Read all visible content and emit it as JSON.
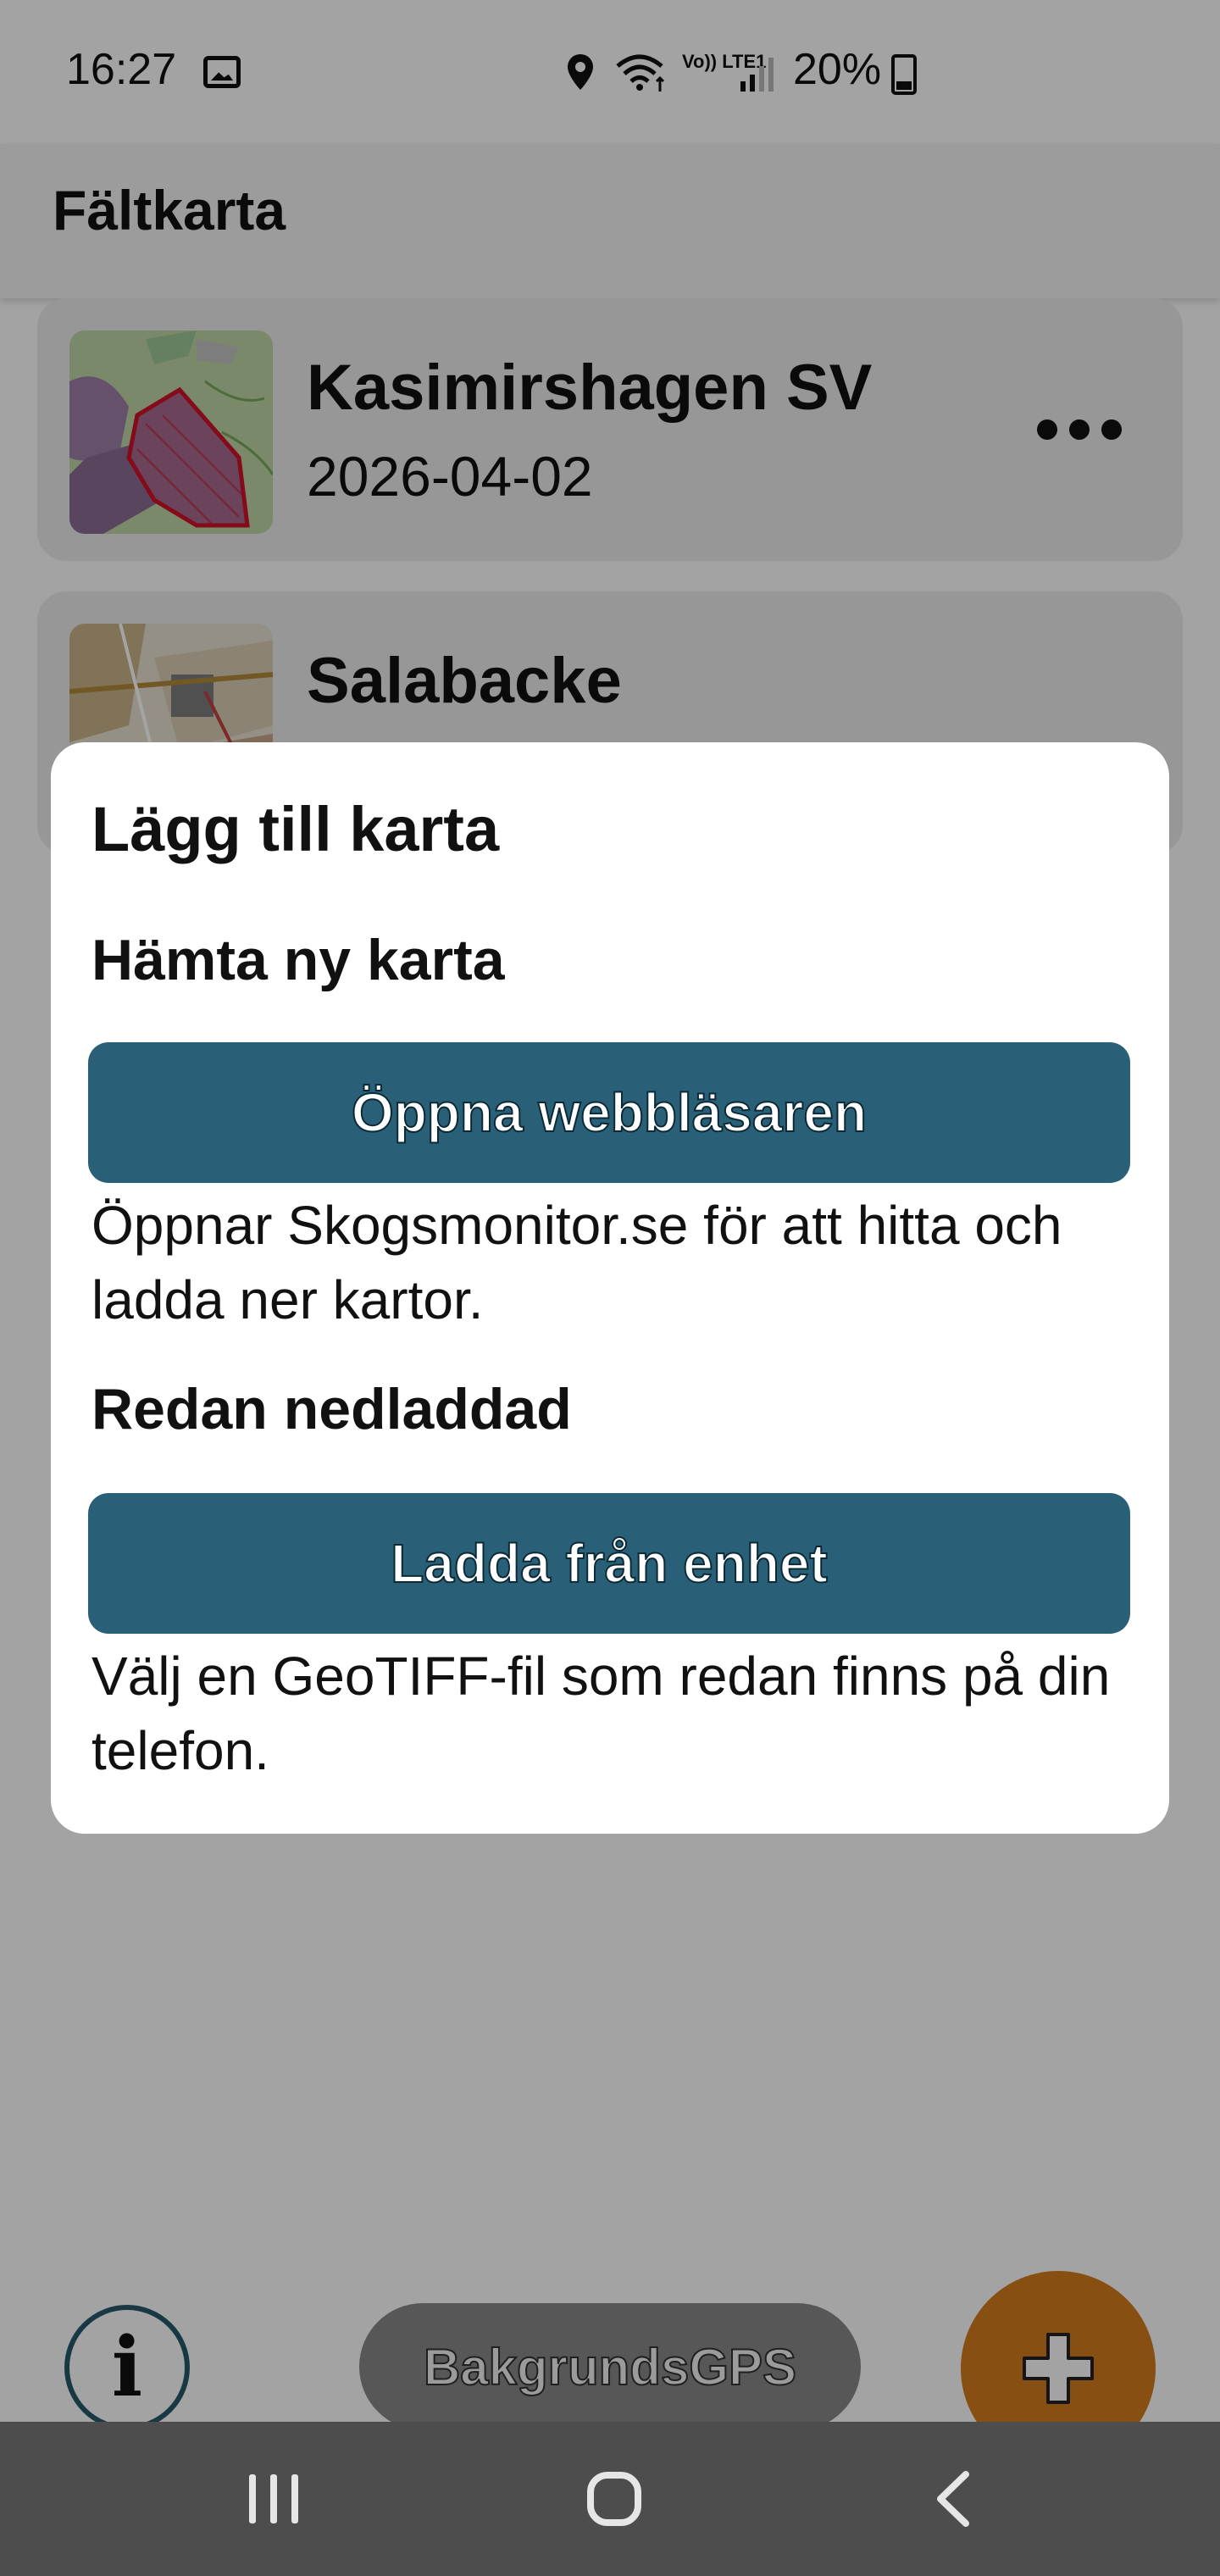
{
  "status_bar": {
    "time": "16:27",
    "network": "Vo)) LTE1",
    "battery_percent": "20%",
    "icons": [
      "gallery-icon",
      "location-icon",
      "wifi-icon",
      "volte-icon",
      "signal-icon",
      "battery-icon"
    ]
  },
  "app_bar": {
    "title": "Fältkarta"
  },
  "maps": [
    {
      "name": "Kasimirshagen SV",
      "date": "2026-04-02"
    },
    {
      "name": "Salabacke",
      "date": ""
    }
  ],
  "dialog": {
    "title": "Lägg till karta",
    "section_download": {
      "title": "Hämta ny karta",
      "button": "Öppna webbläsaren",
      "description": "Öppnar Skogsmonitor.se för att hitta och ladda ner kartor."
    },
    "section_local": {
      "title": "Redan nedladdad",
      "button": "Ladda från enhet",
      "description": "Välj en GeoTIFF-fil som redan finns på din telefon."
    }
  },
  "bottom_controls": {
    "info_label": "i",
    "gps_label": "BakgrundsGPS",
    "fab_icon": "plus-icon",
    "fab_color": "#d57c1e",
    "accent_color": "#296077"
  },
  "nav_bar": {
    "icons": [
      "recents-icon",
      "home-icon",
      "back-icon"
    ]
  }
}
